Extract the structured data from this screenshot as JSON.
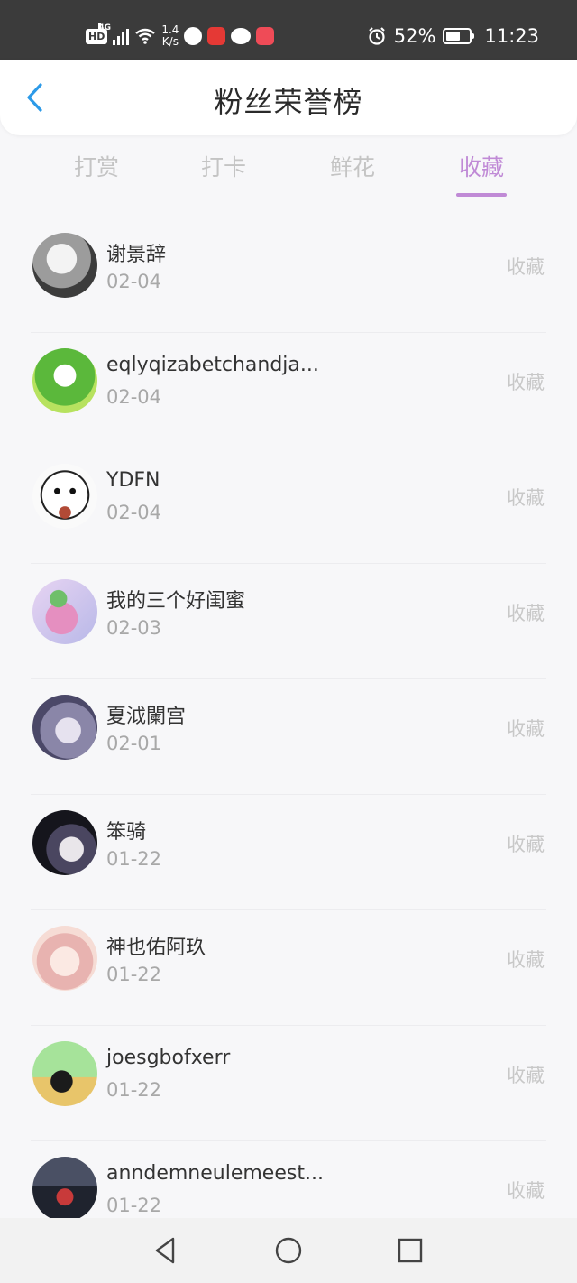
{
  "status_bar": {
    "hd": "HD",
    "network": "4G",
    "speed_value": "1.4",
    "speed_unit": "K/s",
    "battery_percent": "52%",
    "time": "11:23"
  },
  "header": {
    "title": "粉丝荣誉榜"
  },
  "tabs": [
    {
      "label": "打赏",
      "active": false
    },
    {
      "label": "打卡",
      "active": false
    },
    {
      "label": "鲜花",
      "active": false
    },
    {
      "label": "收藏",
      "active": true
    }
  ],
  "list": [
    {
      "name": "谢景辞",
      "date": "02-04",
      "action": "收藏",
      "avatar_color": "#b9b9b9"
    },
    {
      "name": "eqlyqizabetchandja...",
      "date": "02-04",
      "action": "收藏",
      "avatar_color": "#8ccf5a"
    },
    {
      "name": "YDFN",
      "date": "02-04",
      "action": "收藏",
      "avatar_color": "#f2f2f2"
    },
    {
      "name": "我的三个好闺蜜",
      "date": "02-03",
      "action": "收藏",
      "avatar_color": "#d8a8df"
    },
    {
      "name": "夏泧闌宫",
      "date": "02-01",
      "action": "收藏",
      "avatar_color": "#6e6a8c"
    },
    {
      "name": "笨骑",
      "date": "01-22",
      "action": "收藏",
      "avatar_color": "#2a2a34"
    },
    {
      "name": "神也佑阿玖",
      "date": "01-22",
      "action": "收藏",
      "avatar_color": "#f1c9c4"
    },
    {
      "name": "joesgbofxerr",
      "date": "01-22",
      "action": "收藏",
      "avatar_color": "#7fc36a"
    },
    {
      "name": "anndemneulemeest...",
      "date": "01-22",
      "action": "收藏",
      "avatar_color": "#2d3240"
    }
  ],
  "colors": {
    "accent": "#c08ad6",
    "back_icon": "#2c9ae8"
  }
}
